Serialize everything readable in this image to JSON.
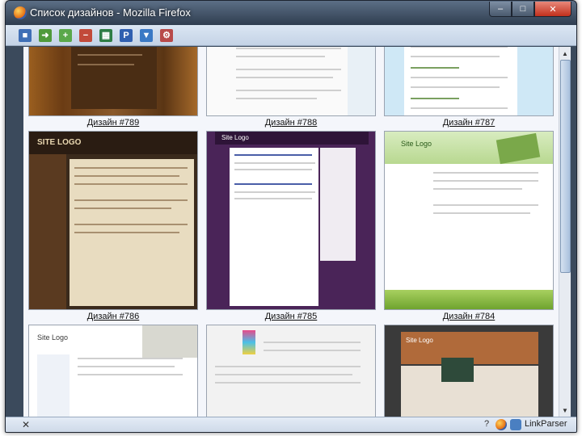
{
  "window": {
    "title": "Список дизайнов - Mozilla Firefox"
  },
  "titlebar_buttons": {
    "minimize": "‒",
    "maximize": "□",
    "close": "✕"
  },
  "toolbar": {
    "icons": [
      "save-icon",
      "export-icon",
      "add-icon",
      "remove-icon",
      "grid-view-icon",
      "text-tool-icon",
      "filter-icon",
      "settings-icon"
    ]
  },
  "gallery": {
    "rows": [
      [
        {
          "caption": "Дизайн #789"
        },
        {
          "caption": "Дизайн #788"
        },
        {
          "caption": "Дизайн #787"
        }
      ],
      [
        {
          "caption": "Дизайн #786"
        },
        {
          "caption": "Дизайн #785"
        },
        {
          "caption": "Дизайн #784"
        }
      ],
      [
        {
          "caption": ""
        },
        {
          "caption": ""
        },
        {
          "caption": ""
        }
      ]
    ],
    "thumb_texts": {
      "site_logo": "Site Logo",
      "site_logo_upper": "SITE LOGO",
      "header_785": "Site Logo"
    }
  },
  "statusbar": {
    "close": "✕",
    "help": "?",
    "addon_label": "LinkParser"
  },
  "colors": {
    "frame": "#3b4a5c",
    "toolbar": "#c4d3e6",
    "content_bg": "#f4f6fb"
  }
}
